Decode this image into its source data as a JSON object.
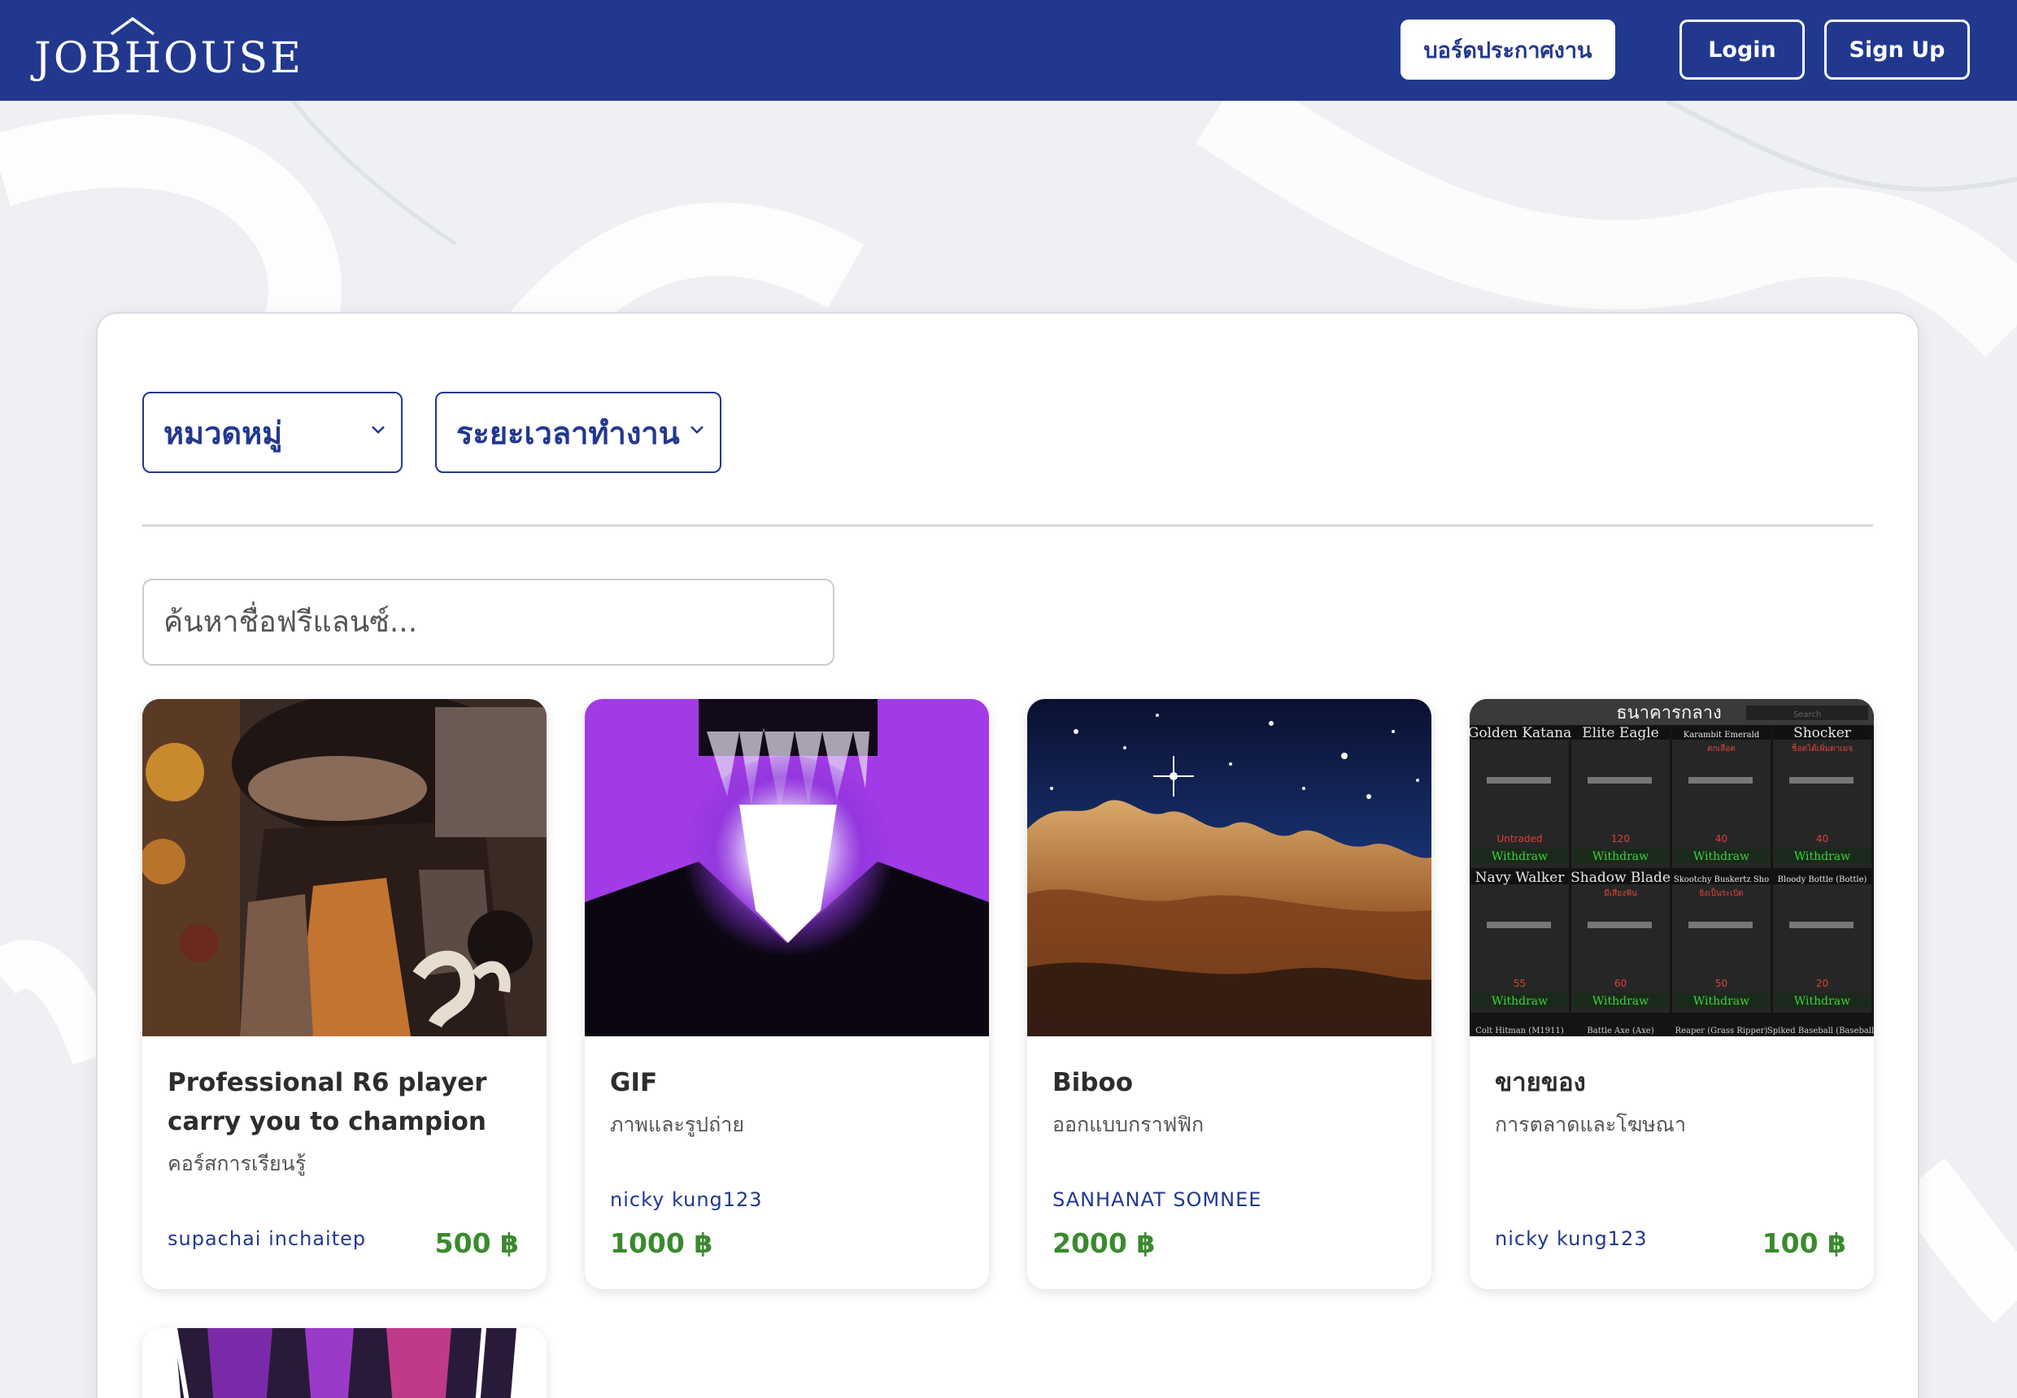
{
  "brand": {
    "logo_text": "JOBHOUSE",
    "primary_color": "#22388f",
    "price_color": "#3a8a2e"
  },
  "nav": {
    "board_label": "บอร์ดประกาศงาน",
    "login_label": "Login",
    "signup_label": "Sign Up"
  },
  "filters": {
    "category_label": "หมวดหมู่",
    "duration_label": "ระยะเวลาทำงาน"
  },
  "search": {
    "placeholder": "ค้นหาชื่อฟรีแลนซ์..."
  },
  "cards": [
    {
      "title": "Professional R6 player carry you to champion",
      "category": "คอร์สการเรียนรู้",
      "seller": "supachai inchaitep",
      "price": "500 ฿"
    },
    {
      "title": "GIF",
      "category": "ภาพและรูปถ่าย",
      "seller": "nicky kung123",
      "price": "1000 ฿"
    },
    {
      "title": "Biboo",
      "category": "ออกแบบกราฟฟิก",
      "seller": "SANHANAT SOMNEE",
      "price": "2000 ฿"
    },
    {
      "title": "ขายของ",
      "category": "การตลาดและโฆษณา",
      "seller": "nicky kung123",
      "price": "100 ฿"
    }
  ],
  "game_inventory": {
    "header": "ธนาคารกลาง",
    "search_placeholder": "Search",
    "withdraw_label": "Withdraw",
    "items": [
      {
        "name": "Golden Katana",
        "value": "Untraded",
        "note": ""
      },
      {
        "name": "Elite Eagle",
        "value": "120",
        "note": ""
      },
      {
        "name": "Karambit Emerald",
        "value": "40",
        "note": "ตกเลือด"
      },
      {
        "name": "Shocker",
        "value": "40",
        "note": "ช็อตได้เพิ่มดาเมจ"
      },
      {
        "name": "Navy Walker",
        "value": "55",
        "note": ""
      },
      {
        "name": "Shadow Blade",
        "value": "60",
        "note": "มีเสียงฟัน"
      },
      {
        "name": "Skootchy Buskertz Sho",
        "value": "50",
        "note": "ยิงเป็นระเบิด"
      },
      {
        "name": "Bloody Bottle (Bottle)",
        "value": "20",
        "note": ""
      }
    ],
    "bottom_labels": [
      "Colt Hitman (M1911)",
      "Battle Axe (Axe)",
      "Reaper (Grass Ripper)",
      "Spiked Baseball (Baseball)"
    ]
  }
}
